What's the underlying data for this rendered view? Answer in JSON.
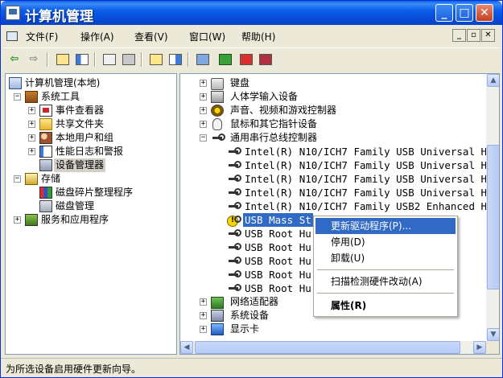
{
  "window": {
    "title": "计算机管理",
    "controls": {
      "minimize": "_",
      "maximize": "□",
      "close": "✕"
    }
  },
  "menubar": {
    "items": [
      "文件(F)",
      "操作(A)",
      "查看(V)",
      "窗口(W)",
      "帮助(H)"
    ],
    "mdi": [
      "_",
      "▫",
      "✕"
    ]
  },
  "toolbar": {
    "icons": [
      "back-arrow-icon",
      "forward-arrow-icon",
      "up-folder-icon",
      "show-hide-tree-icon",
      "properties-icon",
      "print-icon",
      "help-icon",
      "view-icon",
      "scan-hardware-icon",
      "update-driver-icon",
      "uninstall-icon",
      "disable-icon"
    ]
  },
  "tree": {
    "root": "计算机管理(本地)",
    "system_tools": "系统工具",
    "event_viewer": "事件查看器",
    "shared_folders": "共享文件夹",
    "local_users": "本地用户和组",
    "perf_logs": "性能日志和警报",
    "device_manager": "设备管理器",
    "storage": "存储",
    "defrag": "磁盘碎片整理程序",
    "disk_mgmt": "磁盘管理",
    "services": "服务和应用程序"
  },
  "devices": {
    "keyboard": "键盘",
    "hid": "人体学输入设备",
    "sound": "声音、视频和游戏控制器",
    "mouse": "鼠标和其它指针设备",
    "usb_group": "通用串行总线控制器",
    "usb_items": [
      "Intel(R) N10/ICH7 Family USB Universal H",
      "Intel(R) N10/ICH7 Family USB Universal H",
      "Intel(R) N10/ICH7 Family USB Universal H",
      "Intel(R) N10/ICH7 Family USB Universal H",
      "Intel(R) N10/ICH7 Family USB2 Enhanced H",
      "USB Mass St",
      "USB Root Hu",
      "USB Root Hu",
      "USB Root Hu",
      "USB Root Hu",
      "USB Root Hu"
    ],
    "network": "网络适配器",
    "system": "系统设备",
    "display": "显示卡"
  },
  "context_menu": {
    "update_driver": "更新驱动程序(P)...",
    "disable": "停用(D)",
    "uninstall": "卸载(U)",
    "scan": "扫描检测硬件改动(A)",
    "properties": "属性(R)"
  },
  "status": {
    "text": "为所选设备启用硬件更新向导。"
  },
  "colors": {
    "title_blue": "#0548d4",
    "selection": "#316ac5",
    "warning_yellow": "#f5d800"
  }
}
